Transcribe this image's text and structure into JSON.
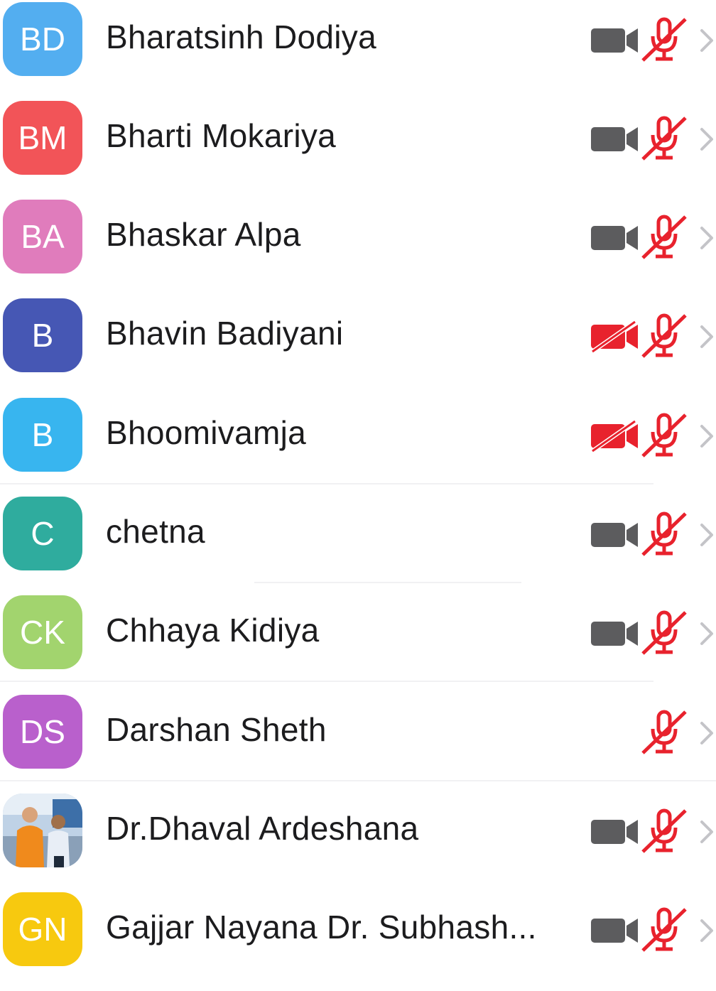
{
  "participants": [
    {
      "initials": "BD",
      "name": "Bharatsinh Dodiya",
      "color": "#53aef0",
      "camera": "on",
      "mic": "muted"
    },
    {
      "initials": "BM",
      "name": "Bharti Mokariya",
      "color": "#f25458",
      "camera": "on",
      "mic": "muted"
    },
    {
      "initials": "BA",
      "name": "Bhaskar Alpa",
      "color": "#e07cbc",
      "camera": "on",
      "mic": "muted"
    },
    {
      "initials": "B",
      "name": "Bhavin Badiyani",
      "color": "#4657b4",
      "camera": "off",
      "mic": "muted"
    },
    {
      "initials": "B",
      "name": "Bhoomivamja",
      "color": "#38b5ef",
      "camera": "off",
      "mic": "muted"
    },
    {
      "initials": "C",
      "name": "chetna",
      "color": "#2fac9e",
      "camera": "on",
      "mic": "muted"
    },
    {
      "initials": "CK",
      "name": "Chhaya Kidiya",
      "color": "#a2d46e",
      "camera": "on",
      "mic": "muted"
    },
    {
      "initials": "DS",
      "name": "Darshan Sheth",
      "color": "#b960cc",
      "camera": "none",
      "mic": "muted"
    },
    {
      "initials": "",
      "name": "Dr.Dhaval Ardeshana",
      "color": "#c8d6e6",
      "camera": "on",
      "mic": "muted",
      "avatar": "photo"
    },
    {
      "initials": "GN",
      "name": "Gajjar Nayana Dr. Subhash...",
      "color": "#f7c90f",
      "camera": "on",
      "mic": "muted"
    }
  ],
  "colors": {
    "camera_on": "#5c5c5e",
    "muted_red": "#e8222d",
    "chevron": "#c4c4c8"
  },
  "icons": {
    "camera_on": "video-camera-icon",
    "camera_off": "video-camera-off-icon",
    "mic": "microphone-muted-icon",
    "chevron": "chevron-right-icon"
  }
}
